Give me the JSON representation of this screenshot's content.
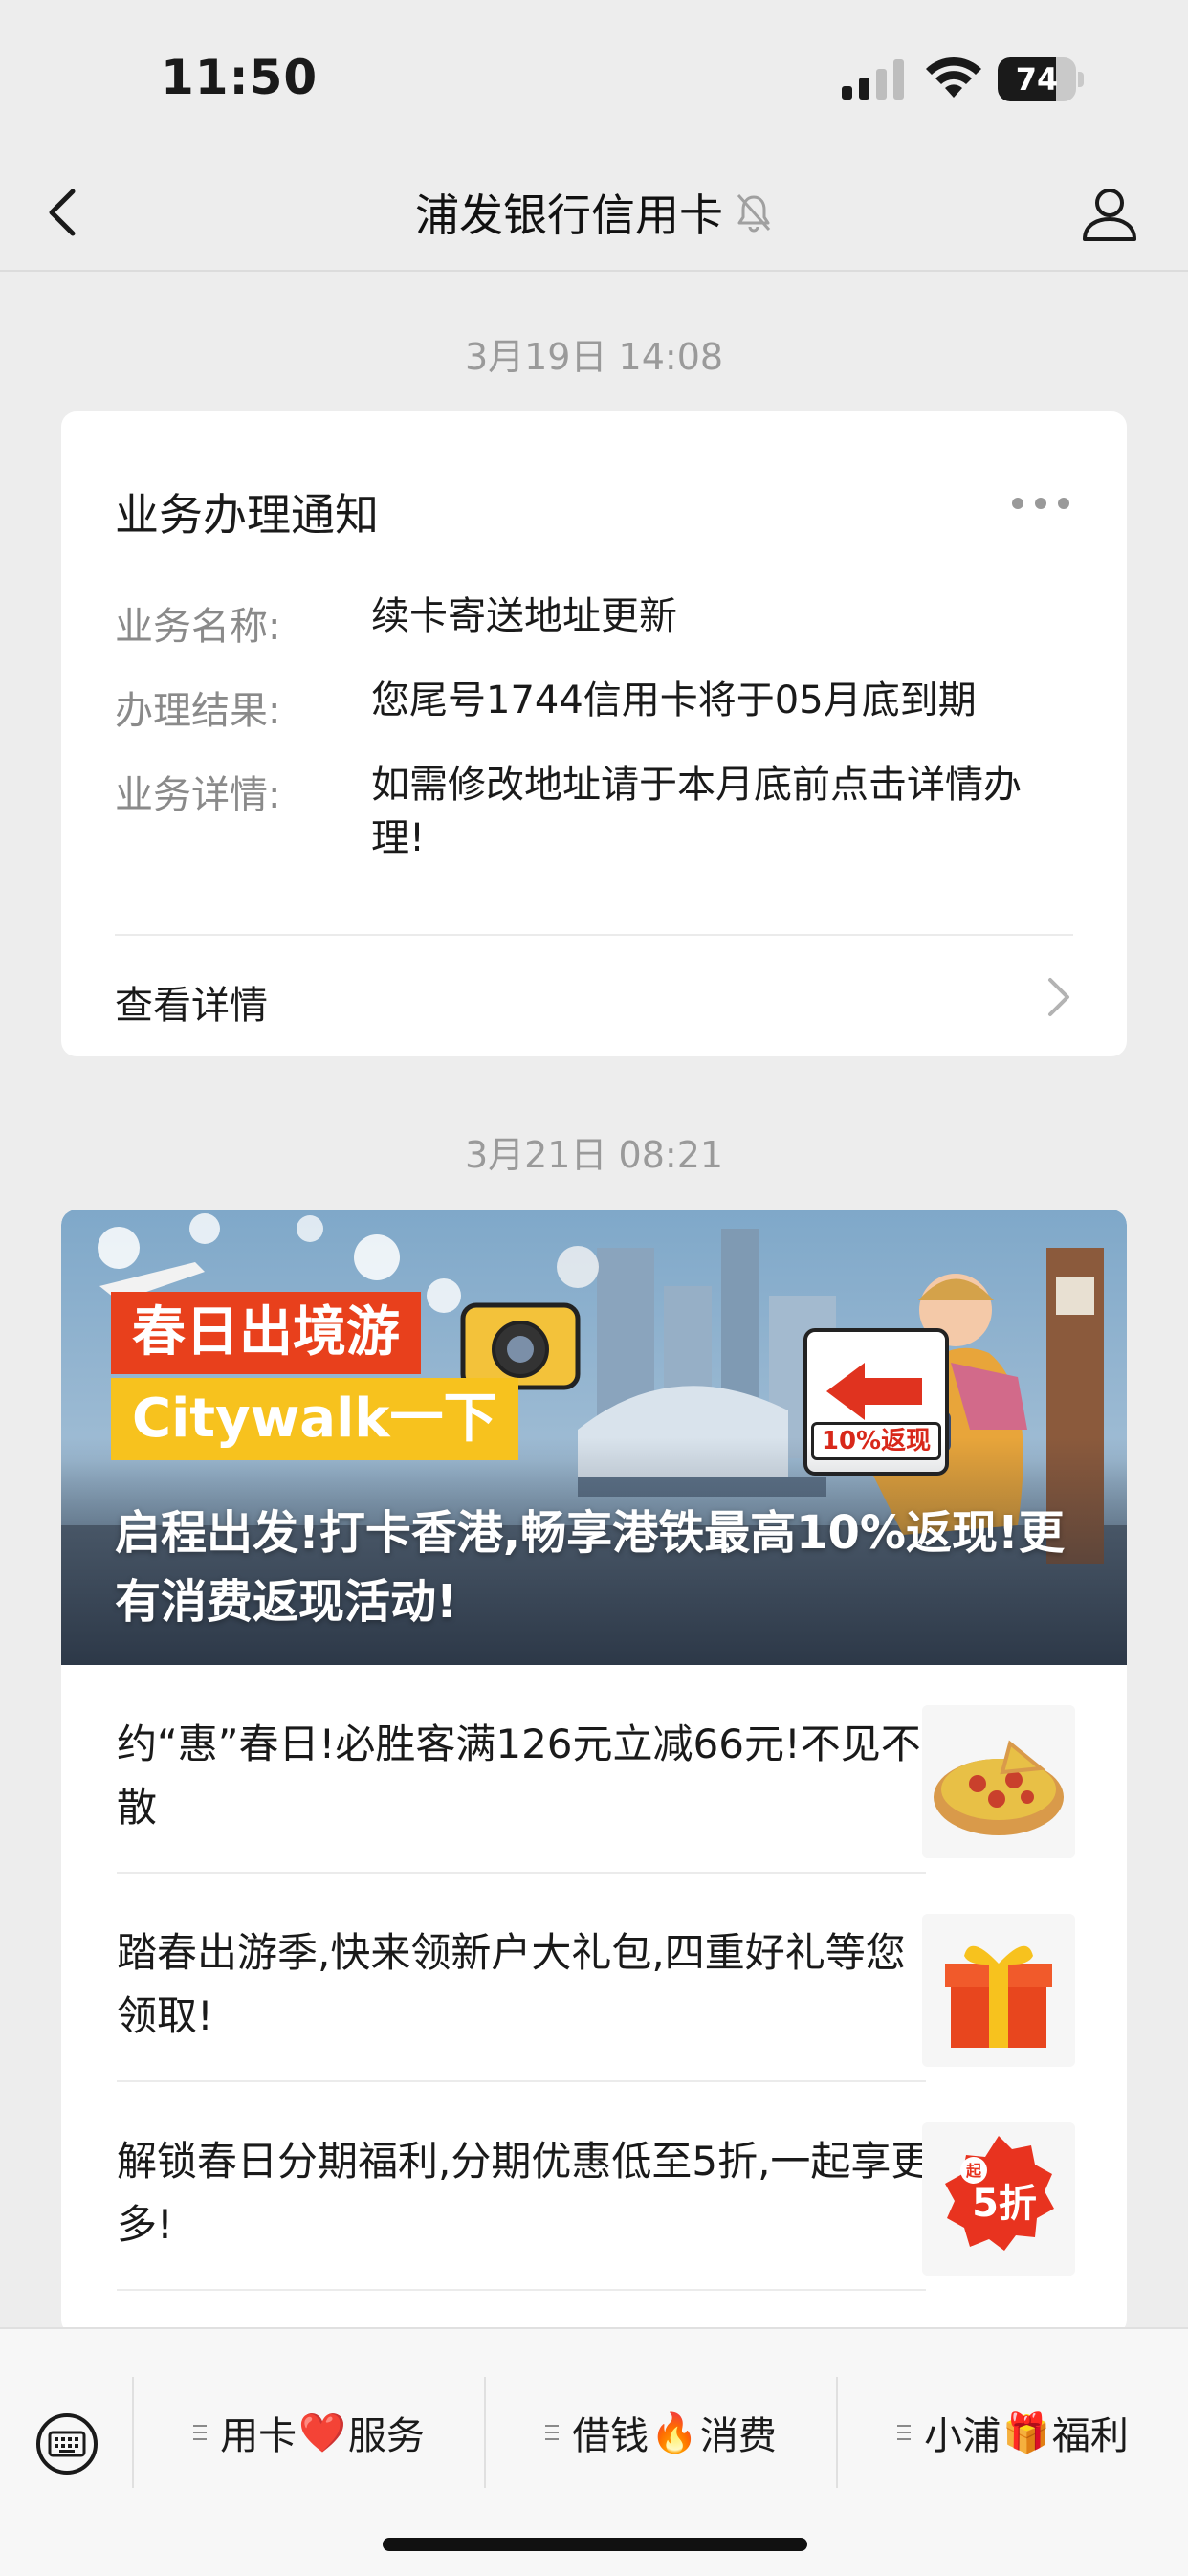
{
  "status_bar": {
    "time": "11:50",
    "battery_level": "74",
    "battery_fraction": 0.74
  },
  "nav": {
    "title": "浦发银行信用卡",
    "back_icon": "chevron-left-icon",
    "mute_icon": "bell-muted-icon",
    "profile_icon": "person-icon"
  },
  "messages": [
    {
      "timestamp": "3月19日 14:08",
      "type": "notice",
      "title": "业务办理通知",
      "fields": [
        {
          "label": "业务名称:",
          "value": "续卡寄送地址更新"
        },
        {
          "label": "办理结果:",
          "value": "您尾号1744信用卡将于05月底到期"
        },
        {
          "label": "业务详情:",
          "value": "如需修改地址请于本月底前点击详情办理!"
        }
      ],
      "link_label": "查看详情"
    },
    {
      "timestamp": "3月21日 08:21",
      "type": "articles",
      "banner": {
        "tag_line_1": "春日出境游",
        "tag_line_2": "Citywalk一下",
        "chip": "10%返现",
        "caption": "启程出发!打卡香港,畅享港铁最高10%返现!更有消费返现活动!"
      },
      "items": [
        {
          "text": "约“惠”春日!必胜客满126元立减66元!不见不散",
          "thumb_icon": "pizza-icon"
        },
        {
          "text": "踏春出游季,快来领新户大礼包,四重好礼等您领取!",
          "thumb_icon": "gift-box-icon"
        },
        {
          "text": "解锁春日分期福利,分期优惠低至5折,一起享更多!",
          "thumb_icon": "discount-badge-icon",
          "thumb_text": "5折",
          "thumb_small": "起"
        }
      ]
    }
  ],
  "bottom_menu": {
    "keyboard_icon": "keyboard-icon",
    "items": [
      {
        "left": "用卡",
        "emoji": "❤️",
        "right": "服务"
      },
      {
        "left": "借钱",
        "emoji": "🔥",
        "right": "消费"
      },
      {
        "left": "小浦",
        "emoji": "🎁",
        "right": "福利"
      }
    ]
  },
  "colors": {
    "background": "#ededed",
    "card": "#ffffff",
    "banner_tag_red": "#e8401c",
    "banner_tag_yellow": "#f7c21e",
    "muted_text": "#9a9a9a"
  }
}
